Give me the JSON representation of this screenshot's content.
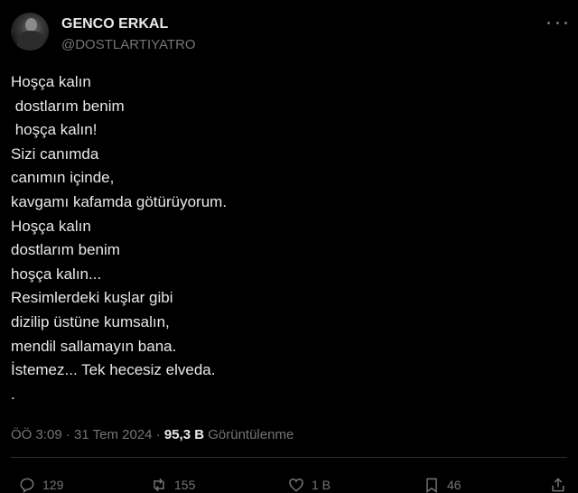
{
  "author": {
    "name": "GENCO ERKAL",
    "handle": "@DOSTLARTIYATRO"
  },
  "tweet": {
    "lines": [
      "Hoşça kalın",
      " dostlarım benim",
      " hoşça kalın!",
      "Sizi canımda",
      "canımın içinde,",
      "kavgamı kafamda götürüyorum.",
      "Hoşça kalın",
      "dostlarım benim",
      "hoşça kalın...",
      "Resimlerdeki kuşlar gibi",
      "dizilip üstüne kumsalın,",
      "mendil sallamayın bana.",
      "İstemez... Tek hecesiz elveda.",
      "."
    ]
  },
  "meta": {
    "time": "ÖÖ 3:09",
    "separator": "·",
    "date": "31 Tem 2024",
    "views_count": "95,3 B",
    "views_label": "Görüntülenme"
  },
  "actions": {
    "replies": "129",
    "reposts": "155",
    "likes": "1 B",
    "bookmarks": "46"
  }
}
